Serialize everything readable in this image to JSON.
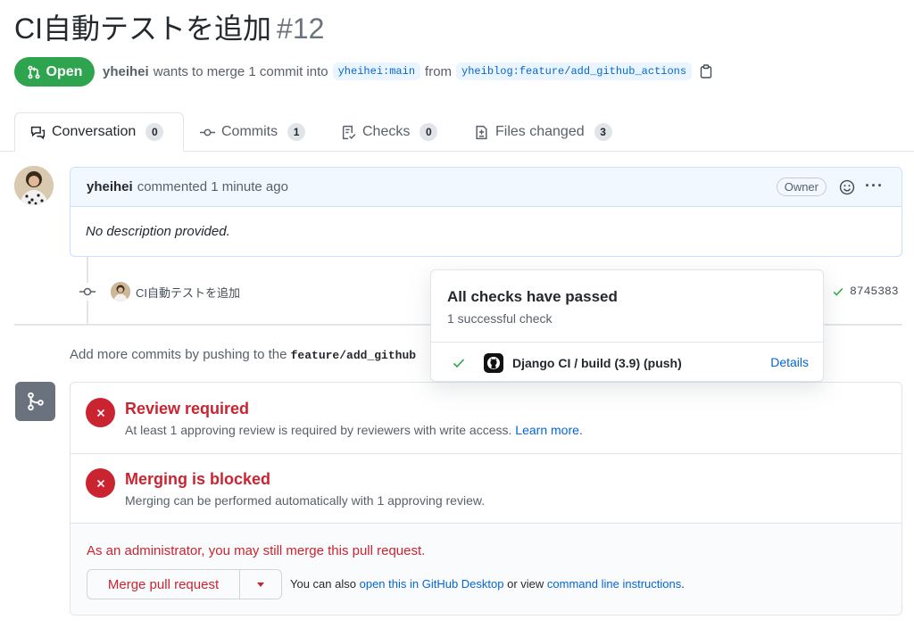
{
  "pr": {
    "title": "CI自動テストを追加",
    "number": "#12",
    "state": "Open",
    "author": "yheihei",
    "merge_text": "wants to merge 1 commit into",
    "base_branch": "yheihei:main",
    "from_text": "from",
    "head_branch": "yheiblog:feature/add_github_actions"
  },
  "tabs": [
    {
      "label": "Conversation",
      "count": "0",
      "icon": "comment-discussion-icon"
    },
    {
      "label": "Commits",
      "count": "1",
      "icon": "git-commit-icon"
    },
    {
      "label": "Checks",
      "count": "0",
      "icon": "checklist-icon"
    },
    {
      "label": "Files changed",
      "count": "3",
      "icon": "file-diff-icon"
    }
  ],
  "comment": {
    "author": "yheihei",
    "meta": "commented 1 minute ago",
    "badge": "Owner",
    "body": "No description provided."
  },
  "commit": {
    "message": "CI自動テストを追加",
    "sha": "8745383"
  },
  "push_note": {
    "text": "Add more commits by pushing to the",
    "branch": "feature/add_github"
  },
  "checks_popover": {
    "title": "All checks have passed",
    "subtitle": "1 successful check",
    "check_name": "Django CI / build (3.9) (push)",
    "details_link": "Details"
  },
  "merge_box": {
    "review_title": "Review required",
    "review_desc": "At least 1 approving review is required by reviewers with write access.",
    "learn_more": "Learn more.",
    "blocked_title": "Merging is blocked",
    "blocked_desc": "Merging can be performed automatically with 1 approving review.",
    "admin_note": "As an administrator, you may still merge this pull request.",
    "merge_button": "Merge pull request",
    "also_prefix": "You can also",
    "desktop_link": "open this in GitHub Desktop",
    "or_view": "or view",
    "cli_link": "command line instructions",
    "period": "."
  },
  "colors": {
    "open_green": "#2ea44f",
    "danger_red": "#cb2431",
    "link_blue": "#0366d6"
  }
}
